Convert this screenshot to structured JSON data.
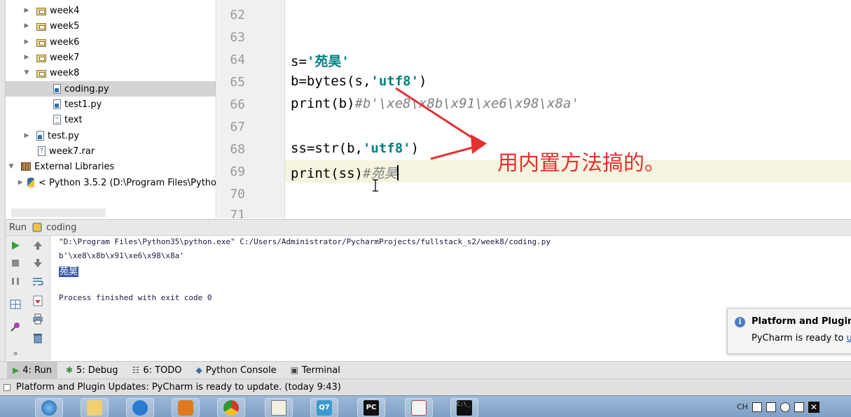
{
  "project_tree": {
    "items": [
      {
        "label": "week4",
        "kind": "folder",
        "arrow": "▶"
      },
      {
        "label": "week5",
        "kind": "folder",
        "arrow": "▶"
      },
      {
        "label": "week6",
        "kind": "folder",
        "arrow": "▶"
      },
      {
        "label": "week7",
        "kind": "folder",
        "arrow": "▶"
      },
      {
        "label": "week8",
        "kind": "folder",
        "arrow": "▼"
      },
      {
        "label": "coding.py",
        "kind": "py"
      },
      {
        "label": "test1.py",
        "kind": "py"
      },
      {
        "label": "text",
        "kind": "txt"
      },
      {
        "label": "test.py",
        "kind": "py",
        "arrow": "▶"
      },
      {
        "label": "week7.rar",
        "kind": "rar"
      },
      {
        "label": "External Libraries",
        "kind": "lib",
        "arrow": "▼"
      },
      {
        "label": "< Python 3.5.2 (D:\\Program Files\\Pytho",
        "kind": "pylib",
        "arrow": "▶"
      }
    ],
    "rar_glyph": "?"
  },
  "editor": {
    "line_numbers": [
      "62",
      "63",
      "64",
      "65",
      "66",
      "67",
      "68",
      "69",
      "70",
      "71"
    ],
    "lines": {
      "l64": {
        "code": "s=",
        "str": "'苑昊'",
        "rest": ""
      },
      "l65": {
        "code": "b=bytes(s,",
        "str": "'utf8'",
        "rest": ")"
      },
      "l66": {
        "code": "print(b)",
        "comment": "#b'\\xe8\\x8b\\x91\\xe6\\x98\\x8a'"
      },
      "l68": {
        "code": "ss=str(b,",
        "str": "'utf8'",
        "rest": ")"
      },
      "l69": {
        "code": "print(ss)",
        "comment": "#苑昊"
      }
    },
    "annotation": "用内置方法搞的。",
    "annotation_color": "#e53030"
  },
  "run_panel": {
    "header_label": "Run",
    "config_name": "coding",
    "console_lines": {
      "command": "\"D:\\Program Files\\Python35\\python.exe\" C:/Users/Administrator/PycharmProjects/fullstack_s2/week8/coding.py",
      "bytes_output": "b'\\xe8\\x8b\\x91\\xe6\\x98\\x8a'",
      "str_output": "苑昊",
      "exit": "Process finished with exit code 0"
    },
    "toolbar_icons": [
      "run-icon",
      "stop-icon",
      "pause-icon",
      "up-arrow-icon",
      "down-arrow-icon",
      "soft-wrap-icon",
      "layout-icon",
      "scroll-end-icon",
      "pin-icon",
      "print-icon",
      "trash-icon"
    ],
    "more_glyph": "»"
  },
  "notification": {
    "title": "Platform and Plugin U",
    "body": "PyCharm is ready to ",
    "link": "up",
    "icon_glyph": "i"
  },
  "tool_tabs": [
    {
      "label": "4: Run",
      "icon": "▶"
    },
    {
      "label": "5: Debug",
      "icon": "✱"
    },
    {
      "label": "6: TODO",
      "icon": "☷"
    },
    {
      "label": "Python Console",
      "icon": "◆"
    },
    {
      "label": "Terminal",
      "icon": "▣"
    }
  ],
  "status_bar": {
    "message": "Platform and Plugin Updates: PyCharm is ready to update. (today 9:43)"
  },
  "taskbar": {
    "apps": [
      "ie-icon",
      "explorer-icon",
      "browser-icon",
      "media-icon",
      "chrome-icon",
      "notepad-icon",
      "qq-icon",
      "pycharm-icon",
      "paint-icon",
      "cmd-icon"
    ],
    "pycharm_label": "PC",
    "qq_label": "Q7",
    "cmd_label": "C:\\_",
    "tray_lang": "CH"
  }
}
